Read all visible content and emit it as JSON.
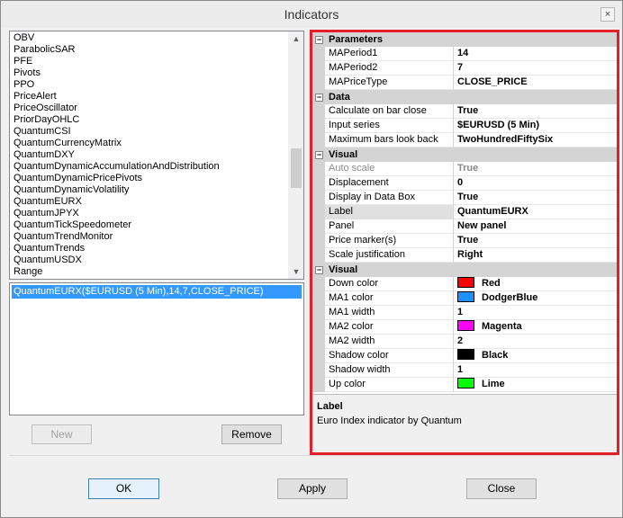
{
  "window": {
    "title": "Indicators",
    "close_label": "×"
  },
  "indicator_list": {
    "items": [
      "OBV",
      "ParabolicSAR",
      "PFE",
      "Pivots",
      "PPO",
      "PriceAlert",
      "PriceOscillator",
      "PriorDayOHLC",
      "QuantumCSI",
      "QuantumCurrencyMatrix",
      "QuantumDXY",
      "QuantumDynamicAccumulationAndDistribution",
      "QuantumDynamicPricePivots",
      "QuantumDynamicVolatility",
      "QuantumEURX",
      "QuantumJPYX",
      "QuantumTickSpeedometer",
      "QuantumTrendMonitor",
      "QuantumTrends",
      "QuantumUSDX",
      "Range"
    ]
  },
  "added_indicators": {
    "items": [
      "QuantumEURX($EURUSD (5 Min),14,7,CLOSE_PRICE)"
    ]
  },
  "buttons": {
    "new": "New",
    "remove": "Remove",
    "ok": "OK",
    "apply": "Apply",
    "close": "Close"
  },
  "properties": {
    "categories": [
      {
        "name": "Parameters",
        "toggle": "⊟",
        "rows": [
          {
            "name": "MAPeriod1",
            "value": "14"
          },
          {
            "name": "MAPeriod2",
            "value": "7"
          },
          {
            "name": "MAPriceType",
            "value": "CLOSE_PRICE"
          }
        ]
      },
      {
        "name": "Data",
        "toggle": "⊟",
        "rows": [
          {
            "name": "Calculate on bar close",
            "value": "True"
          },
          {
            "name": "Input series",
            "value": "$EURUSD (5 Min)"
          },
          {
            "name": "Maximum bars look back",
            "value": "TwoHundredFiftySix"
          }
        ]
      },
      {
        "name": "Visual",
        "toggle": "⊟",
        "rows": [
          {
            "name": "Auto scale",
            "value": "True",
            "muted": true
          },
          {
            "name": "Displacement",
            "value": "0"
          },
          {
            "name": "Display in Data Box",
            "value": "True"
          },
          {
            "name": "Label",
            "value": "QuantumEURX",
            "selected": true
          },
          {
            "name": "Panel",
            "value": "New panel"
          },
          {
            "name": "Price marker(s)",
            "value": "True"
          },
          {
            "name": "Scale justification",
            "value": "Right"
          }
        ]
      },
      {
        "name": "Visual",
        "toggle": "⊟",
        "rows": [
          {
            "name": "Down color",
            "value": "Red",
            "color": "#ff0000"
          },
          {
            "name": "MA1 color",
            "value": "DodgerBlue",
            "color": "#1e90ff"
          },
          {
            "name": "MA1 width",
            "value": "1"
          },
          {
            "name": "MA2 color",
            "value": "Magenta",
            "color": "#ff00ff"
          },
          {
            "name": "MA2 width",
            "value": "2"
          },
          {
            "name": "Shadow color",
            "value": "Black",
            "color": "#000000"
          },
          {
            "name": "Shadow width",
            "value": "1"
          },
          {
            "name": "Up color",
            "value": "Lime",
            "color": "#00ff00"
          }
        ]
      }
    ]
  },
  "description": {
    "title": "Label",
    "text": "Euro Index indicator by Quantum"
  },
  "colors": {
    "highlight_frame": "#e3202a",
    "selection": "#3399ff"
  }
}
